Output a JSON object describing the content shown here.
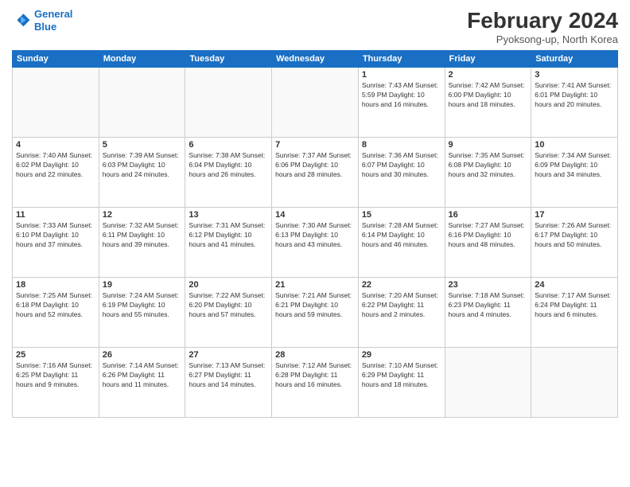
{
  "logo": {
    "line1": "General",
    "line2": "Blue"
  },
  "title": "February 2024",
  "location": "Pyoksong-up, North Korea",
  "days_header": [
    "Sunday",
    "Monday",
    "Tuesday",
    "Wednesday",
    "Thursday",
    "Friday",
    "Saturday"
  ],
  "weeks": [
    [
      {
        "num": "",
        "info": ""
      },
      {
        "num": "",
        "info": ""
      },
      {
        "num": "",
        "info": ""
      },
      {
        "num": "",
        "info": ""
      },
      {
        "num": "1",
        "info": "Sunrise: 7:43 AM\nSunset: 5:59 PM\nDaylight: 10 hours\nand 16 minutes."
      },
      {
        "num": "2",
        "info": "Sunrise: 7:42 AM\nSunset: 6:00 PM\nDaylight: 10 hours\nand 18 minutes."
      },
      {
        "num": "3",
        "info": "Sunrise: 7:41 AM\nSunset: 6:01 PM\nDaylight: 10 hours\nand 20 minutes."
      }
    ],
    [
      {
        "num": "4",
        "info": "Sunrise: 7:40 AM\nSunset: 6:02 PM\nDaylight: 10 hours\nand 22 minutes."
      },
      {
        "num": "5",
        "info": "Sunrise: 7:39 AM\nSunset: 6:03 PM\nDaylight: 10 hours\nand 24 minutes."
      },
      {
        "num": "6",
        "info": "Sunrise: 7:38 AM\nSunset: 6:04 PM\nDaylight: 10 hours\nand 26 minutes."
      },
      {
        "num": "7",
        "info": "Sunrise: 7:37 AM\nSunset: 6:06 PM\nDaylight: 10 hours\nand 28 minutes."
      },
      {
        "num": "8",
        "info": "Sunrise: 7:36 AM\nSunset: 6:07 PM\nDaylight: 10 hours\nand 30 minutes."
      },
      {
        "num": "9",
        "info": "Sunrise: 7:35 AM\nSunset: 6:08 PM\nDaylight: 10 hours\nand 32 minutes."
      },
      {
        "num": "10",
        "info": "Sunrise: 7:34 AM\nSunset: 6:09 PM\nDaylight: 10 hours\nand 34 minutes."
      }
    ],
    [
      {
        "num": "11",
        "info": "Sunrise: 7:33 AM\nSunset: 6:10 PM\nDaylight: 10 hours\nand 37 minutes."
      },
      {
        "num": "12",
        "info": "Sunrise: 7:32 AM\nSunset: 6:11 PM\nDaylight: 10 hours\nand 39 minutes."
      },
      {
        "num": "13",
        "info": "Sunrise: 7:31 AM\nSunset: 6:12 PM\nDaylight: 10 hours\nand 41 minutes."
      },
      {
        "num": "14",
        "info": "Sunrise: 7:30 AM\nSunset: 6:13 PM\nDaylight: 10 hours\nand 43 minutes."
      },
      {
        "num": "15",
        "info": "Sunrise: 7:28 AM\nSunset: 6:14 PM\nDaylight: 10 hours\nand 46 minutes."
      },
      {
        "num": "16",
        "info": "Sunrise: 7:27 AM\nSunset: 6:16 PM\nDaylight: 10 hours\nand 48 minutes."
      },
      {
        "num": "17",
        "info": "Sunrise: 7:26 AM\nSunset: 6:17 PM\nDaylight: 10 hours\nand 50 minutes."
      }
    ],
    [
      {
        "num": "18",
        "info": "Sunrise: 7:25 AM\nSunset: 6:18 PM\nDaylight: 10 hours\nand 52 minutes."
      },
      {
        "num": "19",
        "info": "Sunrise: 7:24 AM\nSunset: 6:19 PM\nDaylight: 10 hours\nand 55 minutes."
      },
      {
        "num": "20",
        "info": "Sunrise: 7:22 AM\nSunset: 6:20 PM\nDaylight: 10 hours\nand 57 minutes."
      },
      {
        "num": "21",
        "info": "Sunrise: 7:21 AM\nSunset: 6:21 PM\nDaylight: 10 hours\nand 59 minutes."
      },
      {
        "num": "22",
        "info": "Sunrise: 7:20 AM\nSunset: 6:22 PM\nDaylight: 11 hours\nand 2 minutes."
      },
      {
        "num": "23",
        "info": "Sunrise: 7:18 AM\nSunset: 6:23 PM\nDaylight: 11 hours\nand 4 minutes."
      },
      {
        "num": "24",
        "info": "Sunrise: 7:17 AM\nSunset: 6:24 PM\nDaylight: 11 hours\nand 6 minutes."
      }
    ],
    [
      {
        "num": "25",
        "info": "Sunrise: 7:16 AM\nSunset: 6:25 PM\nDaylight: 11 hours\nand 9 minutes."
      },
      {
        "num": "26",
        "info": "Sunrise: 7:14 AM\nSunset: 6:26 PM\nDaylight: 11 hours\nand 11 minutes."
      },
      {
        "num": "27",
        "info": "Sunrise: 7:13 AM\nSunset: 6:27 PM\nDaylight: 11 hours\nand 14 minutes."
      },
      {
        "num": "28",
        "info": "Sunrise: 7:12 AM\nSunset: 6:28 PM\nDaylight: 11 hours\nand 16 minutes."
      },
      {
        "num": "29",
        "info": "Sunrise: 7:10 AM\nSunset: 6:29 PM\nDaylight: 11 hours\nand 18 minutes."
      },
      {
        "num": "",
        "info": ""
      },
      {
        "num": "",
        "info": ""
      }
    ]
  ]
}
